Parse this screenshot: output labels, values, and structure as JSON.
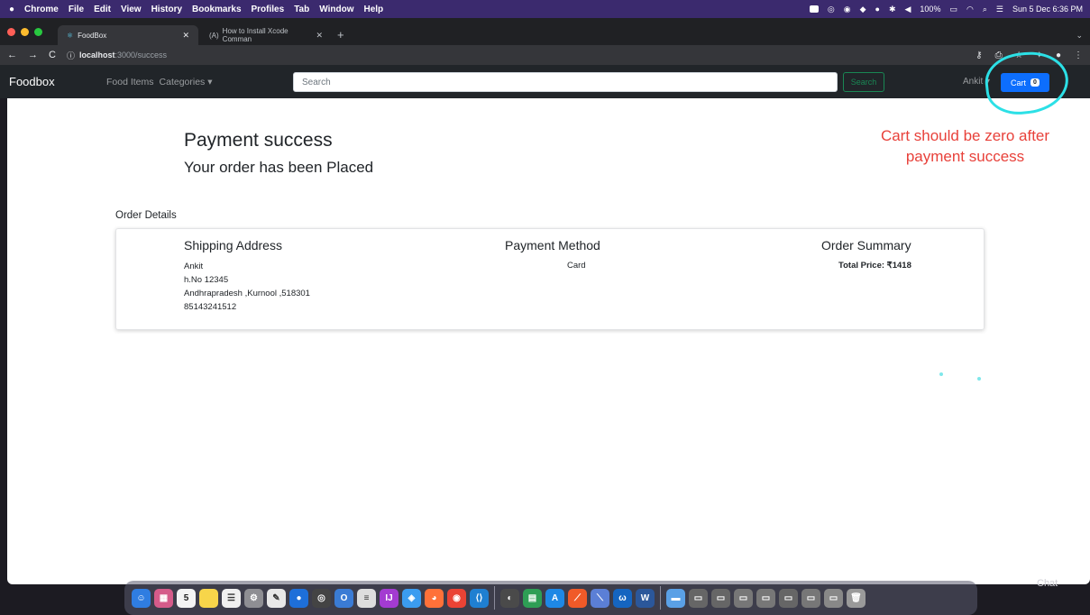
{
  "menubar": {
    "app": "Chrome",
    "items": [
      "File",
      "Edit",
      "View",
      "History",
      "Bookmarks",
      "Profiles",
      "Tab",
      "Window",
      "Help"
    ],
    "battery": "100%",
    "datetime": "Sun 5 Dec 6:36 PM"
  },
  "tabs": {
    "active": "FoodBox",
    "inactive": "How to Install Xcode Comman",
    "inactive_prefix": "(A)"
  },
  "address": {
    "host": "localhost",
    "path": ":3000/success"
  },
  "navbar": {
    "brand": "Foodbox",
    "links": [
      "Food Items",
      "Categories ▾"
    ],
    "search_placeholder": "Search",
    "search_button": "Search",
    "user": "Ankit ▾",
    "cart_label": "Cart",
    "cart_count": "0"
  },
  "page": {
    "title": "Payment success",
    "subtitle": "Your order has been Placed",
    "order_details_label": "Order Details",
    "shipping": {
      "heading": "Shipping Address",
      "name": "Ankit",
      "line1": "h.No 12345",
      "line2": "Andhrapradesh ,Kurnool ,518301",
      "phone": "85143241512"
    },
    "payment": {
      "heading": "Payment Method",
      "method": "Card"
    },
    "summary": {
      "heading": "Order Summary",
      "total": "Total Price: ₹1418"
    }
  },
  "annotation": {
    "text": "Cart should be zero after payment success",
    "color": "#e8413a",
    "circle_color": "#2ce0e6"
  },
  "dock": {
    "calendar_day": "5",
    "chat_label": "Chat"
  }
}
